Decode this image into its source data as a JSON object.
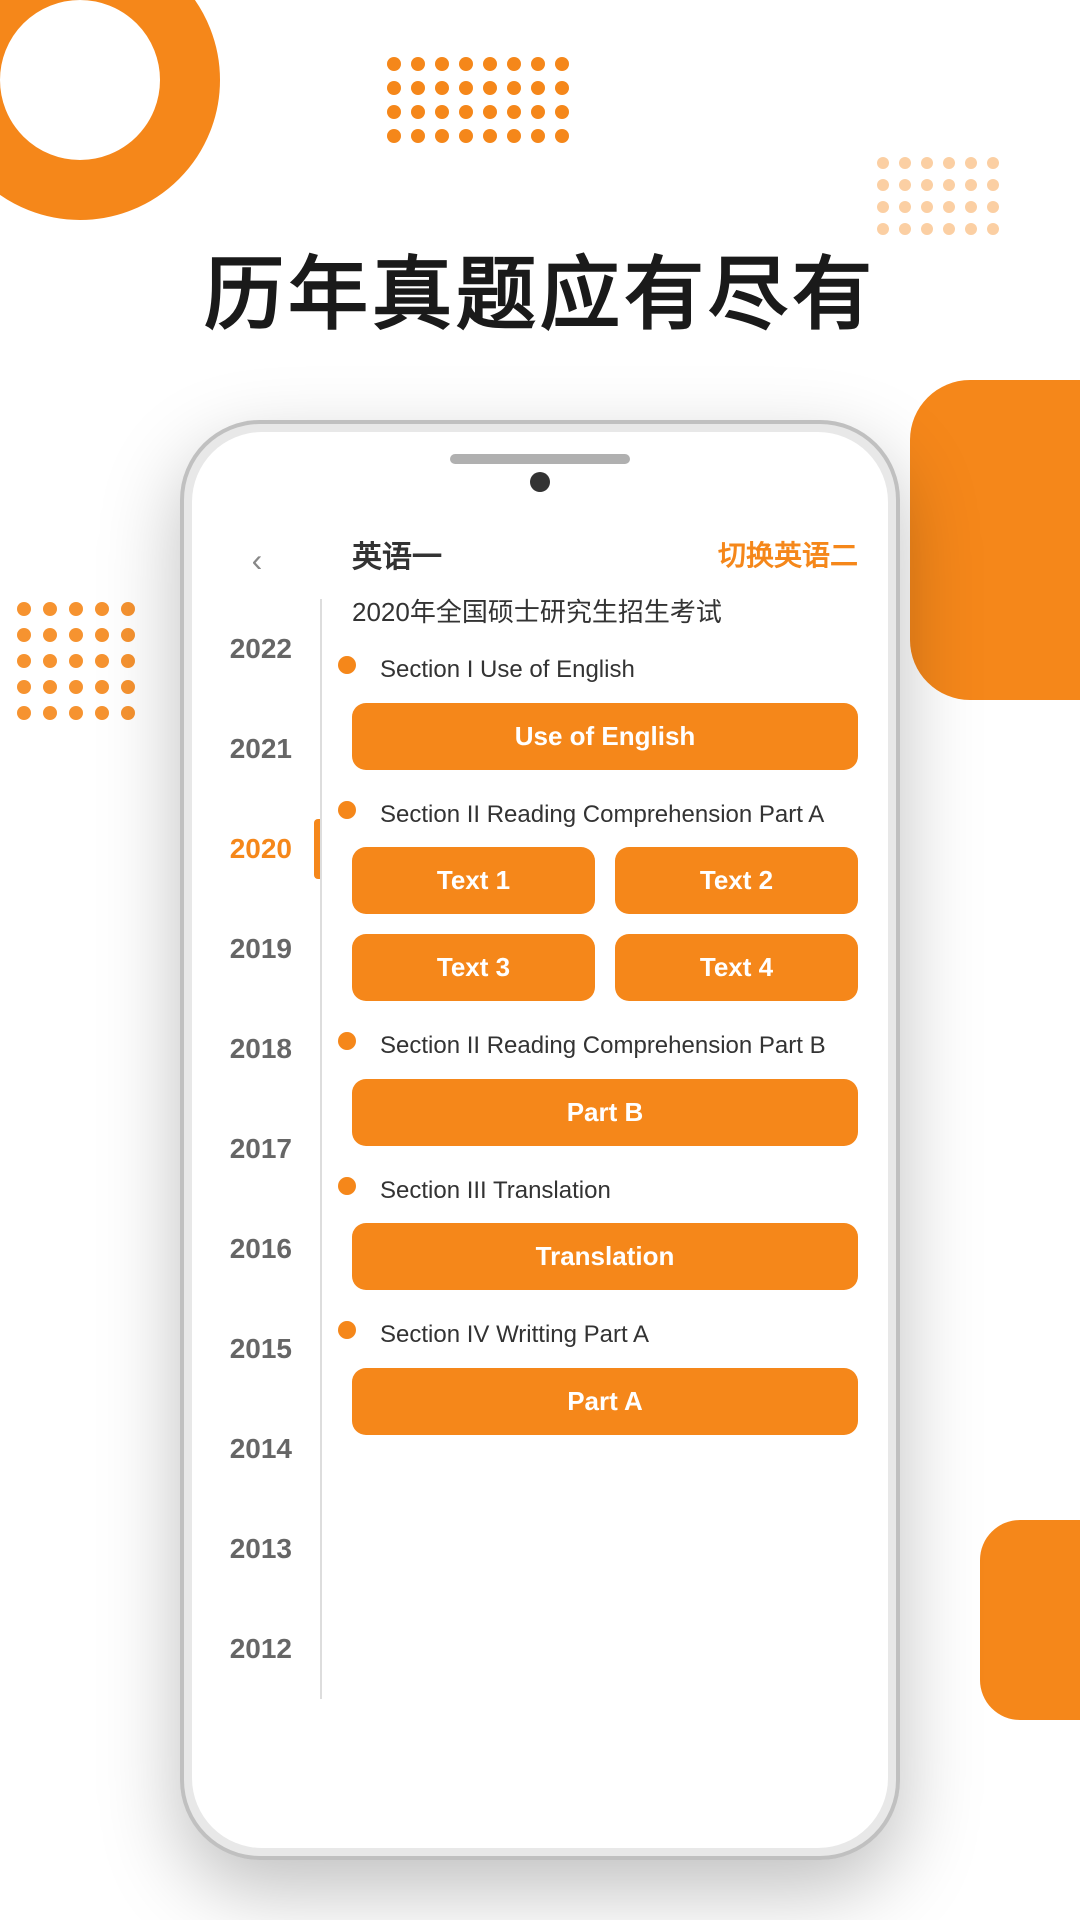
{
  "headline": "历年真题应有尽有",
  "phone": {
    "lang_title": "英语一",
    "lang_switch": "切换英语二",
    "exam_title": "2020年全国硕士研究生招生考试",
    "back_icon": "‹",
    "sections": [
      {
        "id": "s1",
        "label": "Section I Use of English",
        "buttons": [
          "Use of English"
        ]
      },
      {
        "id": "s2",
        "label": "Section II Reading Comprehension Part A",
        "buttons": [
          "Text 1",
          "Text 2",
          "Text 3",
          "Text 4"
        ]
      },
      {
        "id": "s3",
        "label": "Section II Reading Comprehension Part B",
        "buttons": [
          "Part B"
        ]
      },
      {
        "id": "s4",
        "label": "Section III Translation",
        "buttons": [
          "Translation"
        ]
      },
      {
        "id": "s5",
        "label": "Section IV Writting Part A",
        "buttons": [
          "Part A"
        ]
      }
    ],
    "years": [
      "2022",
      "2021",
      "2020",
      "2019",
      "2018",
      "2017",
      "2016",
      "2015",
      "2014",
      "2013",
      "2012"
    ],
    "active_year": "2020"
  },
  "colors": {
    "orange": "#F5871A",
    "text_dark": "#1a1a1a",
    "text_gray": "#666"
  }
}
